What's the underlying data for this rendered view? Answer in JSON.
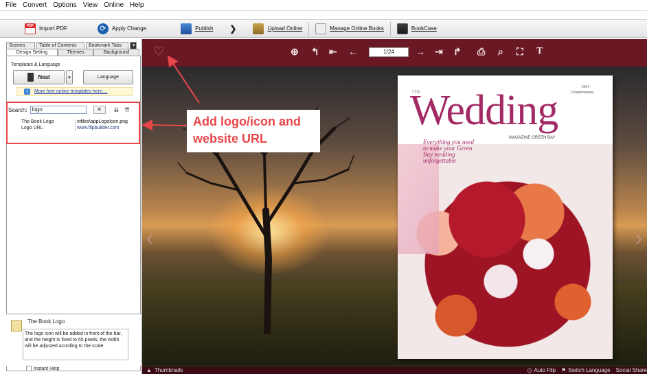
{
  "menu": {
    "items": [
      "File",
      "Convert",
      "Options",
      "View",
      "Online",
      "Help"
    ]
  },
  "toolbar": {
    "import_pdf": "Import PDF",
    "apply_change": "Apply Change",
    "publish": "Publish",
    "upload_online": "Upload Online",
    "manage_online_books": "Manage Online Books",
    "bookcase": "BookCase"
  },
  "left_panel": {
    "tabs_row1": [
      "Scenes",
      "Table of Contents",
      "Bookmark Tabs"
    ],
    "tabs_row2": [
      "Design Setting",
      "Themes",
      "Background"
    ],
    "templates_label": "Templates & Language",
    "template_button": "Neat",
    "language_button": "Language",
    "more_templates_link": "More free online templates here....",
    "search_label": "Search:",
    "search_value": "logo",
    "properties": [
      {
        "name": "The Book Logo",
        "value": "xtfiles\\appLogoIcon.png"
      },
      {
        "name": "Logo URL",
        "value": "www.flipbuilder.com"
      }
    ],
    "help_title": "The Book Logo",
    "help_text": "The logo icon will be added in front of the bar, and the height is fixed to 55 pixels, the width will be adjusted acording to the scale.",
    "instant_help": "Instant Help"
  },
  "viewer": {
    "page_indicator": "1/24",
    "status": {
      "thumbnails": "Thumbnails",
      "auto_flip": "Auto Flip",
      "switch_language": "Switch Language",
      "social_share": "Social Share"
    }
  },
  "book_cover": {
    "the": "THE",
    "title": "Wedding",
    "year": "2014",
    "complimentary": "Complimentary",
    "magazine": "MAGAZINE GREEN BAY",
    "tagline": "Everything you need to make your Green Bay wedding unforgettable"
  },
  "annotation": {
    "line1": "Add logo/icon and",
    "line2": "website URL"
  },
  "colors": {
    "viewer_bar": "#6a1824",
    "annotation_red": "#e8474a",
    "title_magenta": "#a32a64"
  }
}
